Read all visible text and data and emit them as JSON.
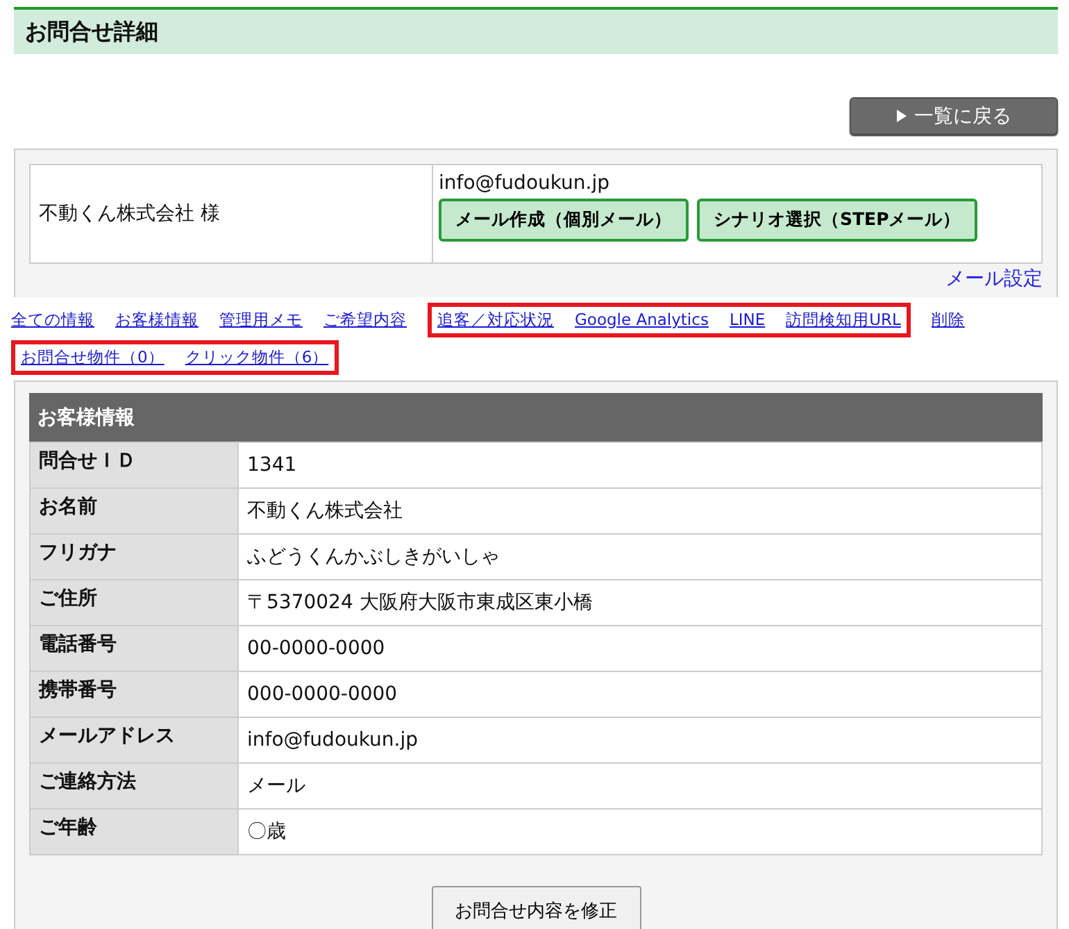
{
  "header": {
    "title": "お問合せ詳細"
  },
  "back_button": {
    "label": "一覧に戻る"
  },
  "contact": {
    "name": "不動くん株式会社 様",
    "email": "info@fudoukun.jp",
    "buttons": [
      "メール作成（個別メール）",
      "シナリオ選択（STEPメール）"
    ],
    "settings_link": "メール設定"
  },
  "nav_rows": [
    [
      {
        "highlighted": false,
        "links": [
          "全ての情報",
          "お客様情報",
          "管理用メモ",
          "ご希望内容"
        ]
      },
      {
        "highlighted": true,
        "links": [
          "追客／対応状況",
          "Google Analytics",
          "LINE",
          "訪問検知用URL"
        ]
      },
      {
        "highlighted": false,
        "links": [
          "削除"
        ]
      }
    ],
    [
      {
        "highlighted": true,
        "links": [
          "お問合せ物件（0）",
          "クリック物件（6）"
        ]
      }
    ]
  ],
  "customer_info": {
    "title": "お客様情報",
    "rows": [
      {
        "label": "問合せＩＤ",
        "value": "1341"
      },
      {
        "label": "お名前",
        "value": "不動くん株式会社"
      },
      {
        "label": "フリガナ",
        "value": "ふどうくんかぶしきがいしゃ"
      },
      {
        "label": "ご住所",
        "value": "〒5370024 大阪府大阪市東成区東小橋"
      },
      {
        "label": "電話番号",
        "value": "00-0000-0000"
      },
      {
        "label": "携帯番号",
        "value": "000-0000-0000"
      },
      {
        "label": "メールアドレス",
        "value": "info@fudoukun.jp"
      },
      {
        "label": "ご連絡方法",
        "value": "メール"
      },
      {
        "label": "ご年齢",
        "value": "〇歳"
      }
    ]
  },
  "edit_button": {
    "label": "お問合せ内容を修正"
  }
}
